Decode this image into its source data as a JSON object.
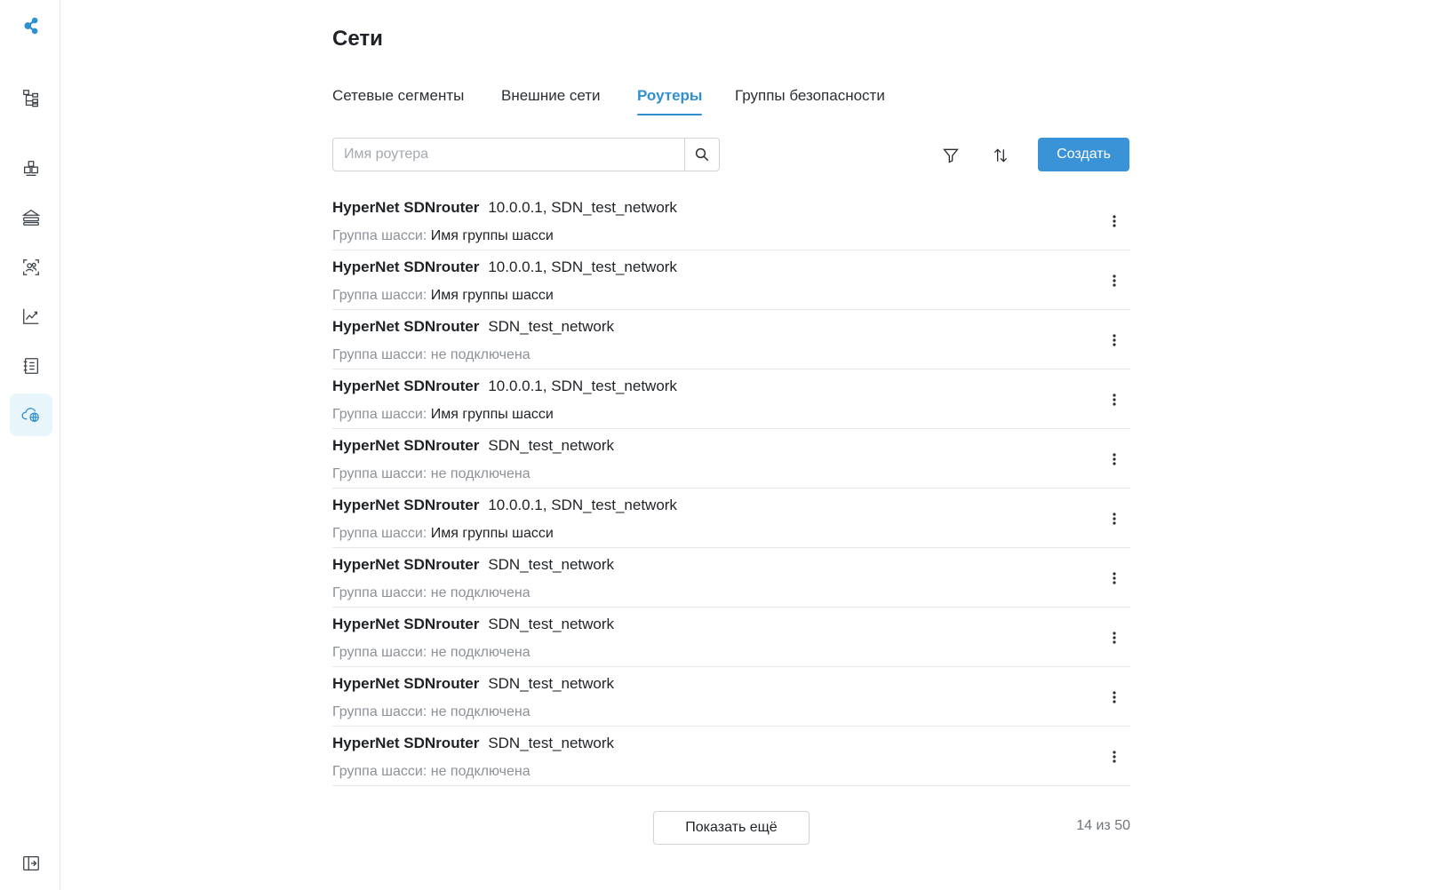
{
  "colors": {
    "accent": "#3a93d6",
    "active_tab": "#2f8fd0",
    "sidebar_active_bg": "#e8f5fb",
    "muted_text": "#8c9298"
  },
  "sidebar": {
    "logo_icon": "share-nodes-icon",
    "items": [
      {
        "icon": "hierarchy-tree-icon"
      },
      {
        "icon": "components-icon"
      },
      {
        "icon": "storage-stack-icon"
      },
      {
        "icon": "users-scan-icon"
      },
      {
        "icon": "chart-line-icon"
      },
      {
        "icon": "notebook-icon"
      },
      {
        "icon": "cloud-network-icon",
        "active": true
      }
    ],
    "collapse_icon": "collapse-sidebar-icon"
  },
  "page": {
    "title": "Сети"
  },
  "tabs": [
    {
      "label": "Сетевые сегменты"
    },
    {
      "label": "Внешние сети"
    },
    {
      "label": "Роутеры",
      "active": true
    },
    {
      "label": "Группы безопасности"
    }
  ],
  "toolbar": {
    "search_placeholder": "Имя роутера",
    "search_value": "",
    "create_label": "Создать"
  },
  "routers": [
    {
      "name": "HyperNet SDNrouter",
      "info": "10.0.0.1, SDN_test_network",
      "chassis_label": "Группа шасси:",
      "chassis_value": "Имя группы шасси",
      "connected": true
    },
    {
      "name": "HyperNet SDNrouter",
      "info": "10.0.0.1, SDN_test_network",
      "chassis_label": "Группа шасси:",
      "chassis_value": "Имя группы шасси",
      "connected": true
    },
    {
      "name": "HyperNet SDNrouter",
      "info": "SDN_test_network",
      "chassis_label": "Группа шасси:",
      "chassis_value": "не подключена",
      "connected": false
    },
    {
      "name": "HyperNet SDNrouter",
      "info": "10.0.0.1, SDN_test_network",
      "chassis_label": "Группа шасси:",
      "chassis_value": "Имя группы шасси",
      "connected": true
    },
    {
      "name": "HyperNet SDNrouter",
      "info": "SDN_test_network",
      "chassis_label": "Группа шасси:",
      "chassis_value": "не подключена",
      "connected": false
    },
    {
      "name": "HyperNet SDNrouter",
      "info": "10.0.0.1, SDN_test_network",
      "chassis_label": "Группа шасси:",
      "chassis_value": "Имя группы шасси",
      "connected": true
    },
    {
      "name": "HyperNet SDNrouter",
      "info": "SDN_test_network",
      "chassis_label": "Группа шасси:",
      "chassis_value": "не подключена",
      "connected": false
    },
    {
      "name": "HyperNet SDNrouter",
      "info": "SDN_test_network",
      "chassis_label": "Группа шасси:",
      "chassis_value": "не подключена",
      "connected": false
    },
    {
      "name": "HyperNet SDNrouter",
      "info": "SDN_test_network",
      "chassis_label": "Группа шасси:",
      "chassis_value": "не подключена",
      "connected": false
    },
    {
      "name": "HyperNet SDNrouter",
      "info": "SDN_test_network",
      "chassis_label": "Группа шасси:",
      "chassis_value": "не подключена",
      "connected": false
    }
  ],
  "footer": {
    "show_more_label": "Показать ещё",
    "counter": "14 из 50"
  }
}
